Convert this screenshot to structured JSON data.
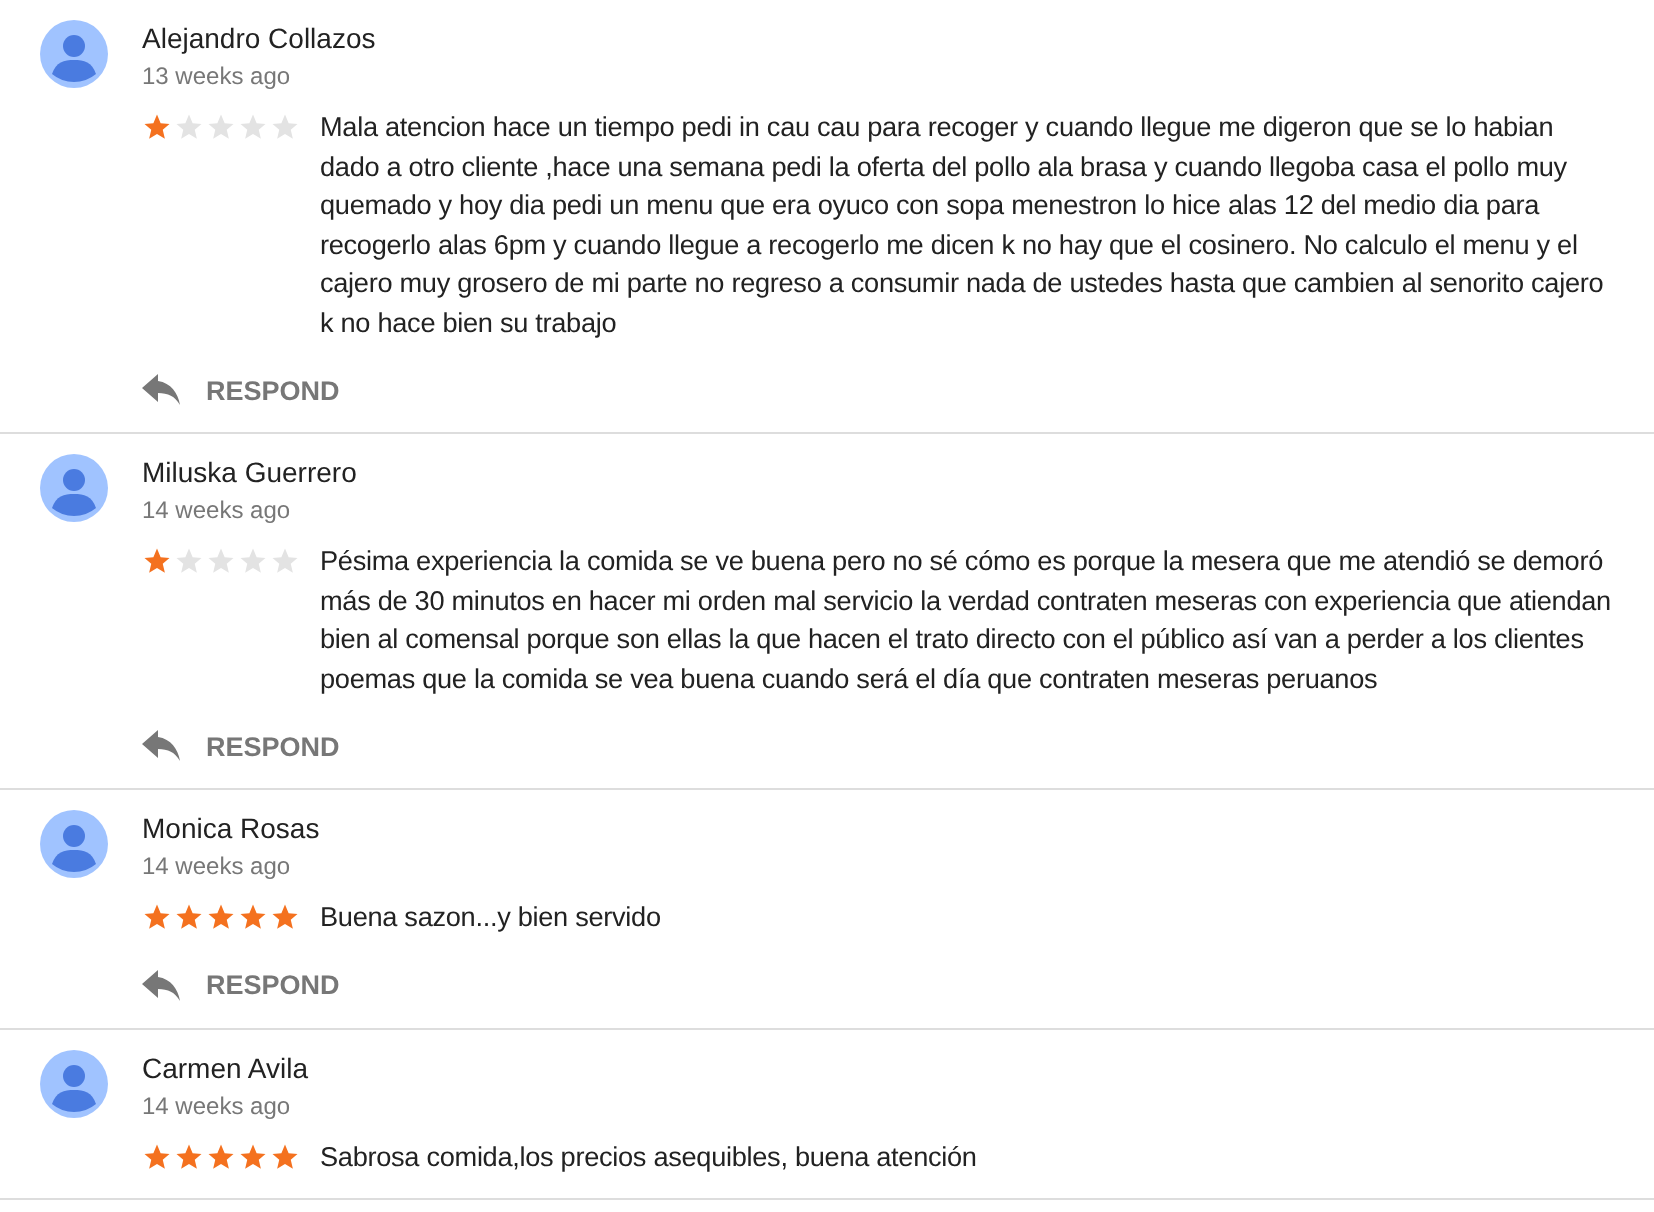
{
  "reviews": [
    {
      "author": "Alejandro Collazos",
      "time": "13 weeks ago",
      "stars": 1,
      "text": "Mala atencion hace un tiempo pedi in cau cau para recoger y cuando llegue me digeron que se lo habian dado a otro cliente ,hace una semana pedi la oferta del pollo ala brasa y cuando llegoba casa el pollo muy quemado y hoy dia pedi un menu que era oyuco con sopa menestron lo hice alas 12 del medio dia para recogerlo alas 6pm y cuando llegue a recogerlo me dicen k no hay que el cosinero. No calculo el menu y el cajero muy grosero de mi parte no regreso a consumir nada de ustedes hasta que cambien al senorito cajero k no hace bien su trabajo",
      "respond": "RESPOND"
    },
    {
      "author": "Miluska Guerrero",
      "time": "14 weeks ago",
      "stars": 1,
      "text": "Pésima experiencia la comida se ve buena pero no sé cómo es porque la mesera que me atendió se demoró más de 30 minutos en hacer mi orden mal servicio la verdad contraten meseras con experiencia que atiendan bien al comensal porque son ellas la que hacen el trato directo con el público así van a perder a los clientes poemas que la comida se vea buena cuando será el día que contraten meseras peruanos",
      "respond": "RESPOND"
    },
    {
      "author": "Monica Rosas",
      "time": "14 weeks ago",
      "stars": 5,
      "text": "Buena sazon...y bien servido",
      "respond": "RESPOND"
    },
    {
      "author": "Carmen Avila",
      "time": "14 weeks ago",
      "stars": 5,
      "text": "Sabrosa comida,los precios asequibles, buena atención"
    }
  ]
}
